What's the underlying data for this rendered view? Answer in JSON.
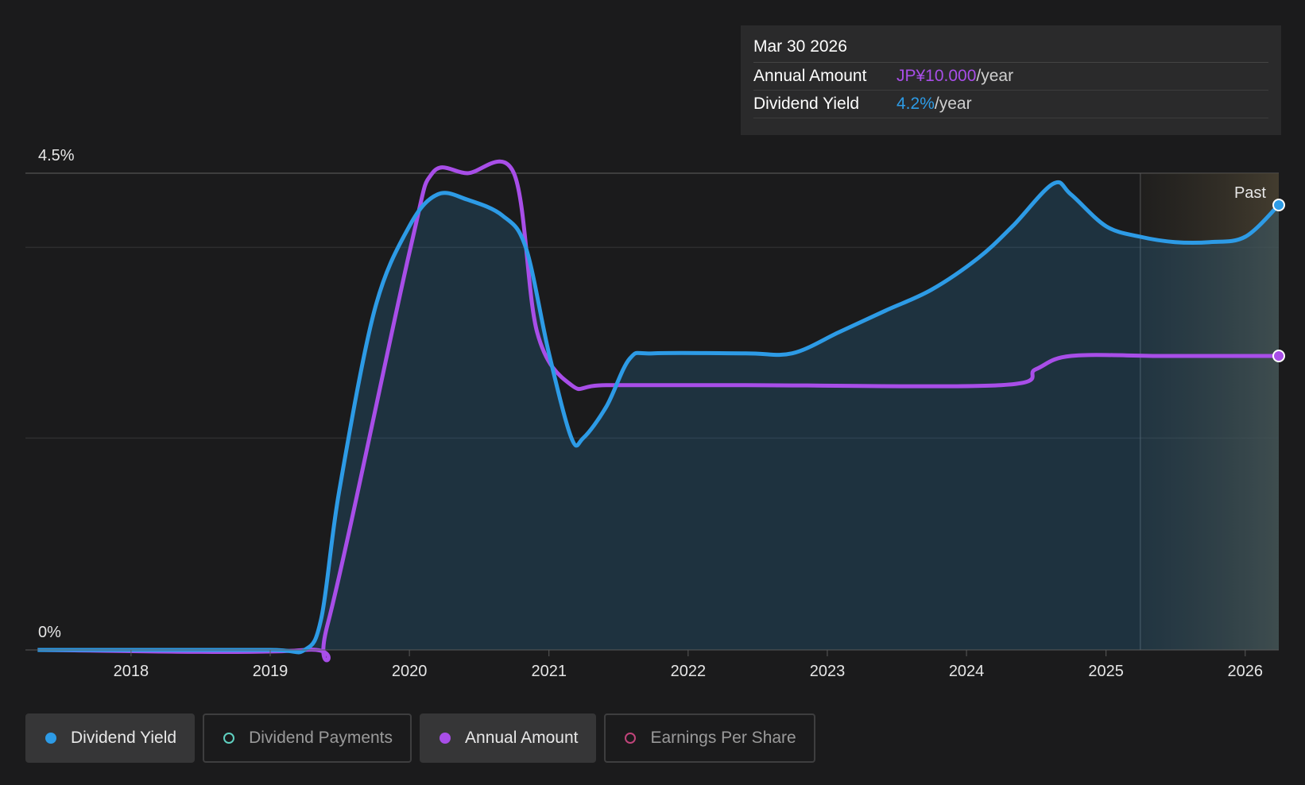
{
  "tooltip": {
    "date": "Mar 30 2026",
    "rows": [
      {
        "label": "Annual Amount",
        "value": "JP¥10.000",
        "unit": "/year"
      },
      {
        "label": "Dividend Yield",
        "value": "4.2%",
        "unit": "/year"
      }
    ]
  },
  "legend": [
    {
      "label": "Dividend Yield",
      "active": true,
      "color": "#2d9be6"
    },
    {
      "label": "Dividend Payments",
      "active": false,
      "color": "#5fd0c0"
    },
    {
      "label": "Annual Amount",
      "active": true,
      "color": "#a84ee8"
    },
    {
      "label": "Earnings Per Share",
      "active": false,
      "color": "#c0447a"
    }
  ],
  "colors": {
    "dividend_yield": "#2d9be6",
    "annual_amount": "#a84ee8",
    "background": "#1b1b1c",
    "future_shade": "#3a3428"
  },
  "chart_data": {
    "type": "line",
    "y_labels": {
      "top": "4.5%",
      "bottom": "0%"
    },
    "ylim": [
      0,
      4.5
    ],
    "xlim": [
      "2017-03-30",
      "2026-03-30"
    ],
    "x_ticks": [
      "2018",
      "2019",
      "2020",
      "2021",
      "2022",
      "2023",
      "2024",
      "2025",
      "2026"
    ],
    "past_label": "Past",
    "past_start": "2025-04-01",
    "grid": true,
    "series": [
      {
        "name": "Dividend Yield",
        "unit": "%",
        "x": [
          "2017-05-01",
          "2018-01-01",
          "2019-01-01",
          "2019-04-01",
          "2019-05-15",
          "2019-07-01",
          "2019-10-01",
          "2020-01-01",
          "2020-03-15",
          "2020-06-01",
          "2020-09-01",
          "2020-11-01",
          "2021-01-01",
          "2021-03-01",
          "2021-04-01",
          "2021-06-01",
          "2021-08-01",
          "2021-10-01",
          "2022-06-01",
          "2022-10-01",
          "2023-02-01",
          "2023-06-01",
          "2023-10-01",
          "2024-02-01",
          "2024-05-01",
          "2024-08-15",
          "2024-10-01",
          "2025-01-01",
          "2025-04-01",
          "2025-07-01",
          "2025-10-01",
          "2026-01-01",
          "2026-03-30"
        ],
        "values": [
          0,
          0,
          0,
          0,
          0.3,
          1.5,
          3.2,
          4.0,
          4.3,
          4.25,
          4.1,
          3.8,
          2.8,
          2.0,
          2.0,
          2.3,
          2.75,
          2.8,
          2.8,
          2.8,
          3.0,
          3.2,
          3.4,
          3.7,
          4.0,
          4.4,
          4.3,
          4.0,
          3.9,
          3.85,
          3.85,
          3.9,
          4.2
        ]
      },
      {
        "name": "Annual Amount",
        "unit": "JP¥",
        "x": [
          "2017-05-01",
          "2019-04-01",
          "2019-06-01",
          "2020-01-01",
          "2020-03-01",
          "2020-06-01",
          "2020-10-01",
          "2020-12-01",
          "2021-03-01",
          "2021-06-01",
          "2022-06-01",
          "2024-04-01",
          "2024-07-01",
          "2024-10-01",
          "2025-06-01",
          "2026-03-30"
        ],
        "values": [
          0,
          0,
          0.5,
          7.5,
          9.0,
          9.0,
          9.0,
          6.0,
          5.0,
          5.0,
          5.0,
          5.0,
          5.3,
          5.55,
          5.55,
          5.55
        ]
      }
    ]
  }
}
